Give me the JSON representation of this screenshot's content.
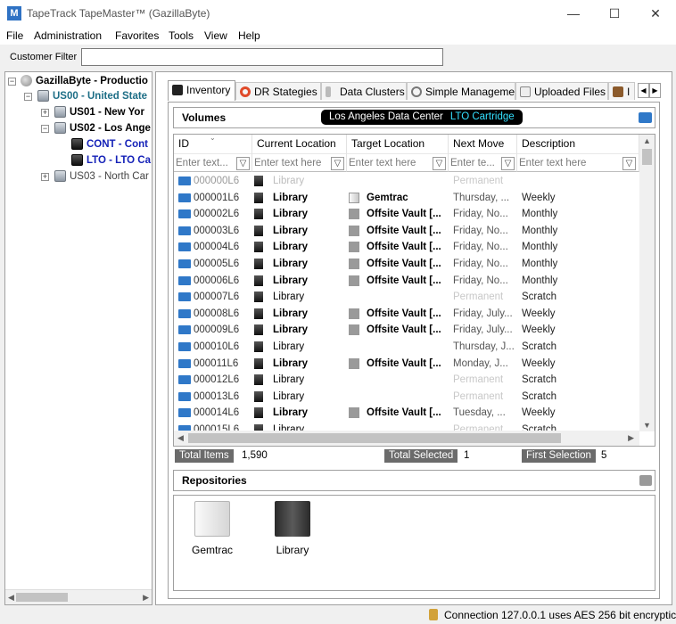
{
  "window": {
    "app_icon": "M",
    "title": "TapeTrack TapeMaster™ (GazillaByte)",
    "minimize_glyph": "—",
    "maximize_glyph": "☐",
    "close_glyph": "✕"
  },
  "menu": [
    "File",
    "Administration",
    "Favorites",
    "Tools",
    "View",
    "Help"
  ],
  "filter": {
    "label": "Customer Filter",
    "value": ""
  },
  "tree": [
    {
      "label": "GazillaByte - Productio",
      "expander": "−"
    },
    {
      "label": "US00 - United State",
      "expander": "−"
    },
    {
      "label": "US01 - New Yor",
      "expander": "+"
    },
    {
      "label": "US02 - Los Ange",
      "expander": "−"
    },
    {
      "label": "CONT - Cont"
    },
    {
      "label": "LTO - LTO Ca"
    },
    {
      "label": "US03 - North Car",
      "expander": "+"
    }
  ],
  "tabs": [
    "Inventory",
    "DR Stategies",
    "Data Clusters",
    "Simple Management",
    "Uploaded Files",
    "I"
  ],
  "tab_scroll": {
    "left": "◀",
    "right": "▶"
  },
  "volumes": {
    "title": "Volumes",
    "crumb_location": "Los Angeles Data Center",
    "crumb_type": "LTO Cartridge",
    "columns": [
      "ID",
      "Current Location",
      "Target Location",
      "Next Move",
      "Description"
    ],
    "filter_placeholders": [
      "Enter text...",
      "Enter text here",
      "Enter text here",
      "Enter te...",
      "Enter text here"
    ],
    "filter_glyph": "▽",
    "rows": [
      {
        "id": "000000L6",
        "current": "Library",
        "target": "",
        "next": "Permanent",
        "desc": "",
        "state": "faded"
      },
      {
        "id": "000001L6",
        "current": "Library",
        "target": "Gemtrac",
        "next": "Thursday, ...",
        "desc": "Weekly",
        "state": "bold",
        "target_icon": "gemtrac"
      },
      {
        "id": "000002L6",
        "current": "Library",
        "target": "Offsite Vault [...",
        "next": "Friday, No...",
        "desc": "Monthly",
        "state": "bold",
        "target_icon": "vault"
      },
      {
        "id": "000003L6",
        "current": "Library",
        "target": "Offsite Vault [...",
        "next": "Friday, No...",
        "desc": "Monthly",
        "state": "bold",
        "target_icon": "vault"
      },
      {
        "id": "000004L6",
        "current": "Library",
        "target": "Offsite Vault [...",
        "next": "Friday, No...",
        "desc": "Monthly",
        "state": "bold",
        "target_icon": "vault"
      },
      {
        "id": "000005L6",
        "current": "Library",
        "target": "Offsite Vault [...",
        "next": "Friday, No...",
        "desc": "Monthly",
        "state": "bold",
        "target_icon": "vault"
      },
      {
        "id": "000006L6",
        "current": "Library",
        "target": "Offsite Vault [...",
        "next": "Friday, No...",
        "desc": "Monthly",
        "state": "bold",
        "target_icon": "vault"
      },
      {
        "id": "000007L6",
        "current": "Library",
        "target": "",
        "next": "Permanent",
        "desc": "Scratch",
        "state": "normal"
      },
      {
        "id": "000008L6",
        "current": "Library",
        "target": "Offsite Vault [...",
        "next": "Friday, July...",
        "desc": "Weekly",
        "state": "bold",
        "target_icon": "vault"
      },
      {
        "id": "000009L6",
        "current": "Library",
        "target": "Offsite Vault [...",
        "next": "Friday, July...",
        "desc": "Weekly",
        "state": "bold",
        "target_icon": "vault"
      },
      {
        "id": "000010L6",
        "current": "Library",
        "target": "",
        "next": "Thursday, J...",
        "desc": "Scratch",
        "state": "normal"
      },
      {
        "id": "000011L6",
        "current": "Library",
        "target": "Offsite Vault [...",
        "next": "Monday, J...",
        "desc": "Weekly",
        "state": "bold",
        "target_icon": "vault"
      },
      {
        "id": "000012L6",
        "current": "Library",
        "target": "",
        "next": "Permanent",
        "desc": "Scratch",
        "state": "normal"
      },
      {
        "id": "000013L6",
        "current": "Library",
        "target": "",
        "next": "Permanent",
        "desc": "Scratch",
        "state": "normal"
      },
      {
        "id": "000014L6",
        "current": "Library",
        "target": "Offsite Vault [...",
        "next": "Tuesday, ...",
        "desc": "Weekly",
        "state": "bold",
        "target_icon": "vault"
      },
      {
        "id": "000015L6",
        "current": "Library",
        "target": "",
        "next": "Permanent",
        "desc": "Scratch",
        "state": "normal"
      }
    ]
  },
  "status_strip": {
    "total_items_label": "Total Items",
    "total_items": "1,590",
    "total_selected_label": "Total Selected",
    "total_selected": "1",
    "first_selection_label": "First Selection",
    "first_selection": "5"
  },
  "repositories": {
    "title": "Repositories",
    "items": [
      {
        "label": "Gemtrac",
        "icon": "gemtrac-repository-icon"
      },
      {
        "label": "Library",
        "icon": "library-repository-icon"
      }
    ]
  },
  "status_bar": {
    "text": "Connection 127.0.0.1 uses AES 256 bit encryptic"
  },
  "colors": {
    "tape_blue": "#2f78c8",
    "crumb_cyan": "#34e0ff",
    "tree_teal": "#1d6e86",
    "tree_navy": "#1522b8"
  }
}
